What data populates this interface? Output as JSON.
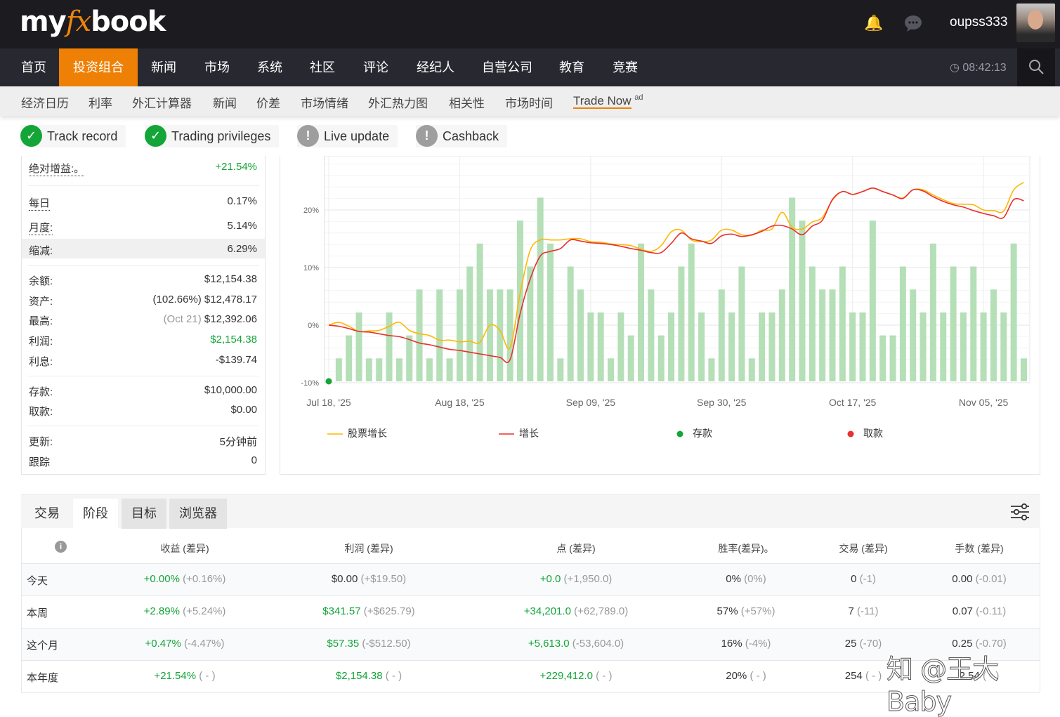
{
  "header": {
    "logo": "myfxbook",
    "username": "oupss333",
    "clock": "08:42:13",
    "icons": [
      "bell-icon",
      "chat-icon",
      "clock-icon",
      "search-icon"
    ]
  },
  "main_nav": [
    {
      "label": "首页"
    },
    {
      "label": "投资组合",
      "active": true
    },
    {
      "label": "新闻"
    },
    {
      "label": "市场"
    },
    {
      "label": "系统"
    },
    {
      "label": "社区"
    },
    {
      "label": "评论"
    },
    {
      "label": "经纪人"
    },
    {
      "label": "自营公司"
    },
    {
      "label": "教育"
    },
    {
      "label": "竞赛"
    }
  ],
  "sub_nav": [
    "经济日历",
    "利率",
    "外汇计算器",
    "新闻",
    "价差",
    "市场情绪",
    "外汇热力图",
    "相关性",
    "市场时间",
    "Trade Now"
  ],
  "sub_nav_ad": "ad",
  "badges": [
    {
      "label": "Track record",
      "status": "ok"
    },
    {
      "label": "Trading privileges",
      "status": "ok"
    },
    {
      "label": "Live update",
      "status": "warn"
    },
    {
      "label": "Cashback",
      "status": "warn"
    }
  ],
  "stats": {
    "abs_gain": {
      "label": "绝对增益:。",
      "value": "+21.54%"
    },
    "daily": {
      "label": "每日",
      "value": "0.17%"
    },
    "monthly": {
      "label": "月度:",
      "value": "5.14%"
    },
    "drawdown": {
      "label": "缩减:",
      "value": "6.29%"
    },
    "balance": {
      "label": "余额:",
      "value": "$12,154.38"
    },
    "equity": {
      "label": "资产:",
      "note": "(102.66%)",
      "value": "$12,478.17"
    },
    "highest": {
      "label": "最高:",
      "note": "(Oct 21)",
      "value": "$12,392.06"
    },
    "profit": {
      "label": "利润:",
      "value": "$2,154.38"
    },
    "interest": {
      "label": "利息:",
      "value": "-$139.74"
    },
    "deposits": {
      "label": "存款:",
      "value": "$10,000.00"
    },
    "withdrawals": {
      "label": "取款:",
      "value": "$0.00"
    },
    "updated": {
      "label": "更新:",
      "value": "5分钟前"
    },
    "tracking": {
      "label": "跟踪",
      "value": "0"
    }
  },
  "chart_data": {
    "type": "line",
    "ylim": [
      -10,
      28
    ],
    "yticks": [
      "20%",
      "10%",
      "0%",
      "-10%"
    ],
    "ytick_values": [
      20,
      10,
      0,
      -10
    ],
    "xtick_labels": [
      "Jul 18, '25",
      "Aug 18, '25",
      "Sep 09, '25",
      "Sep 30, '25",
      "Oct 17, '25",
      "Nov 05, '25"
    ],
    "xtick_index": [
      0,
      13,
      26,
      39,
      52,
      65
    ],
    "grid": true,
    "legend_placement": "bottom",
    "series": [
      {
        "name": "股票增长",
        "color": "#ffb800",
        "values": [
          0,
          0.5,
          -0.2,
          -1.1,
          -1.0,
          -0.9,
          -0.2,
          0.5,
          -0.9,
          -1.5,
          -1.8,
          -2.6,
          -2.6,
          -2.9,
          -2.8,
          -3.0,
          0.0,
          -0.9,
          -3.9,
          5.5,
          13.0,
          14.8,
          14.8,
          14.8,
          15.0,
          15.0,
          14.5,
          14.4,
          14.1,
          14.0,
          13.8,
          13.2,
          12.8,
          13.8,
          16.2,
          16.5,
          14.8,
          14.5,
          14.8,
          16.5,
          16.5,
          15.7,
          15.6,
          16.5,
          16.7,
          19.6,
          17.0,
          16.7,
          17.9,
          18.7,
          21.7,
          23.2,
          22.7,
          23.2,
          23.8,
          23.2,
          22.6,
          22.1,
          23.5,
          23.5,
          22.6,
          21.8,
          21.1,
          21.0,
          20.9,
          20.0,
          19.9,
          19.8,
          23.5,
          24.8
        ]
      },
      {
        "name": "增长",
        "color": "#e8302f",
        "values": [
          0,
          -0.2,
          -0.6,
          -1.1,
          -1.2,
          -1.5,
          -1.8,
          -2.0,
          -2.5,
          -3.1,
          -3.4,
          -3.8,
          -4.2,
          -4.4,
          -4.7,
          -5.0,
          -5.3,
          -5.6,
          -6.0,
          2.0,
          8.0,
          12.0,
          12.8,
          13.3,
          14.8,
          14.6,
          14.3,
          14.2,
          14.0,
          13.7,
          13.3,
          13.0,
          12.6,
          12.6,
          14.2,
          16.0,
          15.0,
          14.6,
          14.2,
          15.5,
          15.8,
          15.4,
          15.7,
          16.3,
          17.2,
          17.3,
          16.7,
          15.7,
          17.2,
          18.2,
          21.8,
          23.2,
          22.7,
          23.2,
          23.8,
          23.2,
          22.6,
          22.0,
          23.5,
          23.3,
          22.3,
          21.5,
          20.9,
          20.5,
          19.9,
          19.4,
          19.0,
          18.7,
          21.8,
          21.6
        ]
      }
    ],
    "bars": {
      "color": "#b5dfb7",
      "values": [
        0,
        1,
        2,
        3,
        1,
        1,
        3,
        1,
        2,
        4,
        1,
        4,
        1,
        4,
        5,
        6,
        4,
        4,
        4,
        7,
        5,
        8,
        6,
        1,
        5,
        4,
        3,
        3,
        1,
        3,
        2,
        6,
        4,
        2,
        3,
        5,
        6,
        3,
        1,
        4,
        3,
        5,
        1,
        3,
        3,
        4,
        8,
        7,
        5,
        4,
        4,
        5,
        3,
        3,
        7,
        2,
        2,
        5,
        4,
        3,
        6,
        3,
        5,
        3,
        5,
        3,
        4,
        3,
        6,
        1
      ]
    },
    "markers": [
      {
        "name": "存款",
        "index": 0,
        "color": "#13a538"
      }
    ],
    "legend": [
      {
        "label": "股票增长",
        "kind": "line",
        "color": "#ffb800"
      },
      {
        "label": "增长",
        "kind": "line",
        "color": "#e8302f"
      },
      {
        "label": "存款",
        "kind": "dot",
        "color": "#13a538"
      },
      {
        "label": "取款",
        "kind": "dot",
        "color": "#e8302f"
      }
    ]
  },
  "tabs": [
    {
      "label": "交易"
    },
    {
      "label": "阶段",
      "selected": true
    },
    {
      "label": "目标"
    },
    {
      "label": "浏览器"
    }
  ],
  "table": {
    "headers": [
      "收益 (差异)",
      "利润 (差异)",
      "点 (差异)",
      "胜率(差异)。",
      "交易 (差异)",
      "手数 (差异)"
    ],
    "rows": [
      {
        "label": "今天",
        "cells": [
          [
            "+0.00%",
            "(+0.16%)",
            "g"
          ],
          [
            "$0.00",
            "(+$19.50)",
            ""
          ],
          [
            "+0.0",
            "(+1,950.0)",
            "g"
          ],
          [
            "0%",
            "(0%)",
            ""
          ],
          [
            "0",
            "(-1)",
            ""
          ],
          [
            "0.00",
            "(-0.01)",
            ""
          ]
        ]
      },
      {
        "label": "本周",
        "cells": [
          [
            "+2.89%",
            "(+5.24%)",
            "g"
          ],
          [
            "$341.57",
            "(+$625.79)",
            "g"
          ],
          [
            "+34,201.0",
            "(+62,789.0)",
            "g"
          ],
          [
            "57%",
            "(+57%)",
            ""
          ],
          [
            "7",
            "(-11)",
            ""
          ],
          [
            "0.07",
            "(-0.11)",
            ""
          ]
        ]
      },
      {
        "label": "这个月",
        "cells": [
          [
            "+0.47%",
            "(-4.47%)",
            "g"
          ],
          [
            "$57.35",
            "(-$512.50)",
            "g"
          ],
          [
            "+5,613.0",
            "(-53,604.0)",
            "g"
          ],
          [
            "16%",
            "(-4%)",
            ""
          ],
          [
            "25",
            "(-70)",
            ""
          ],
          [
            "0.25",
            "(-0.70)",
            ""
          ]
        ]
      },
      {
        "label": "本年度",
        "cells": [
          [
            "+21.54%",
            "( - )",
            "g"
          ],
          [
            "$2,154.38",
            "( - )",
            "g"
          ],
          [
            "+229,412.0",
            "( - )",
            "g"
          ],
          [
            "20%",
            "( - )",
            ""
          ],
          [
            "254",
            "( - )",
            ""
          ],
          [
            "2.54",
            "( - )",
            ""
          ]
        ]
      }
    ]
  },
  "watermark": "知 @王大Baby"
}
